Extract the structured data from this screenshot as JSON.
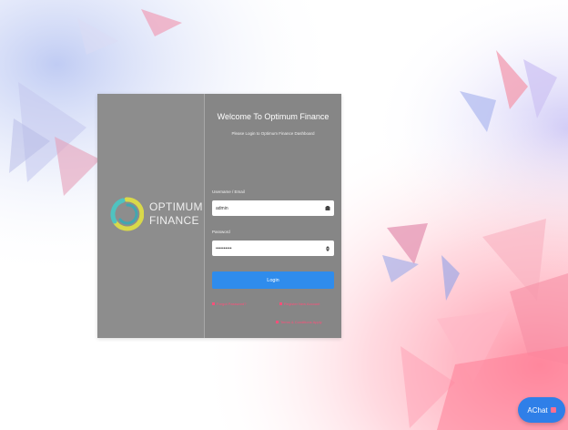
{
  "brand": {
    "logo_line1": "OPTIMUM",
    "logo_line2": "FINANCE"
  },
  "login": {
    "welcome": "Welcome To Optimum Finance",
    "subtitle": "Please Login to Optimum Finance Dashboard",
    "username_label": "Username / Email",
    "username_value": "admin",
    "password_label": "Password",
    "password_value": "••••••••••",
    "login_button": "Login",
    "link_forgot": "Forgot Password?",
    "link_register": "Register New Account",
    "link_terms": "Terms & Conditions Apply"
  },
  "chat": {
    "label": "AChat"
  },
  "colors": {
    "card_left": "#8d8d8d",
    "card_right": "#868686",
    "accent_blue": "#2f8cec",
    "link_pink": "#ff4f7a",
    "logo_yellow": "#d9d94a",
    "logo_teal": "#4fc3c0"
  },
  "icons": {
    "username_field": "user-card-icon",
    "password_field": "eye-icon",
    "chat": "chat-icon"
  }
}
